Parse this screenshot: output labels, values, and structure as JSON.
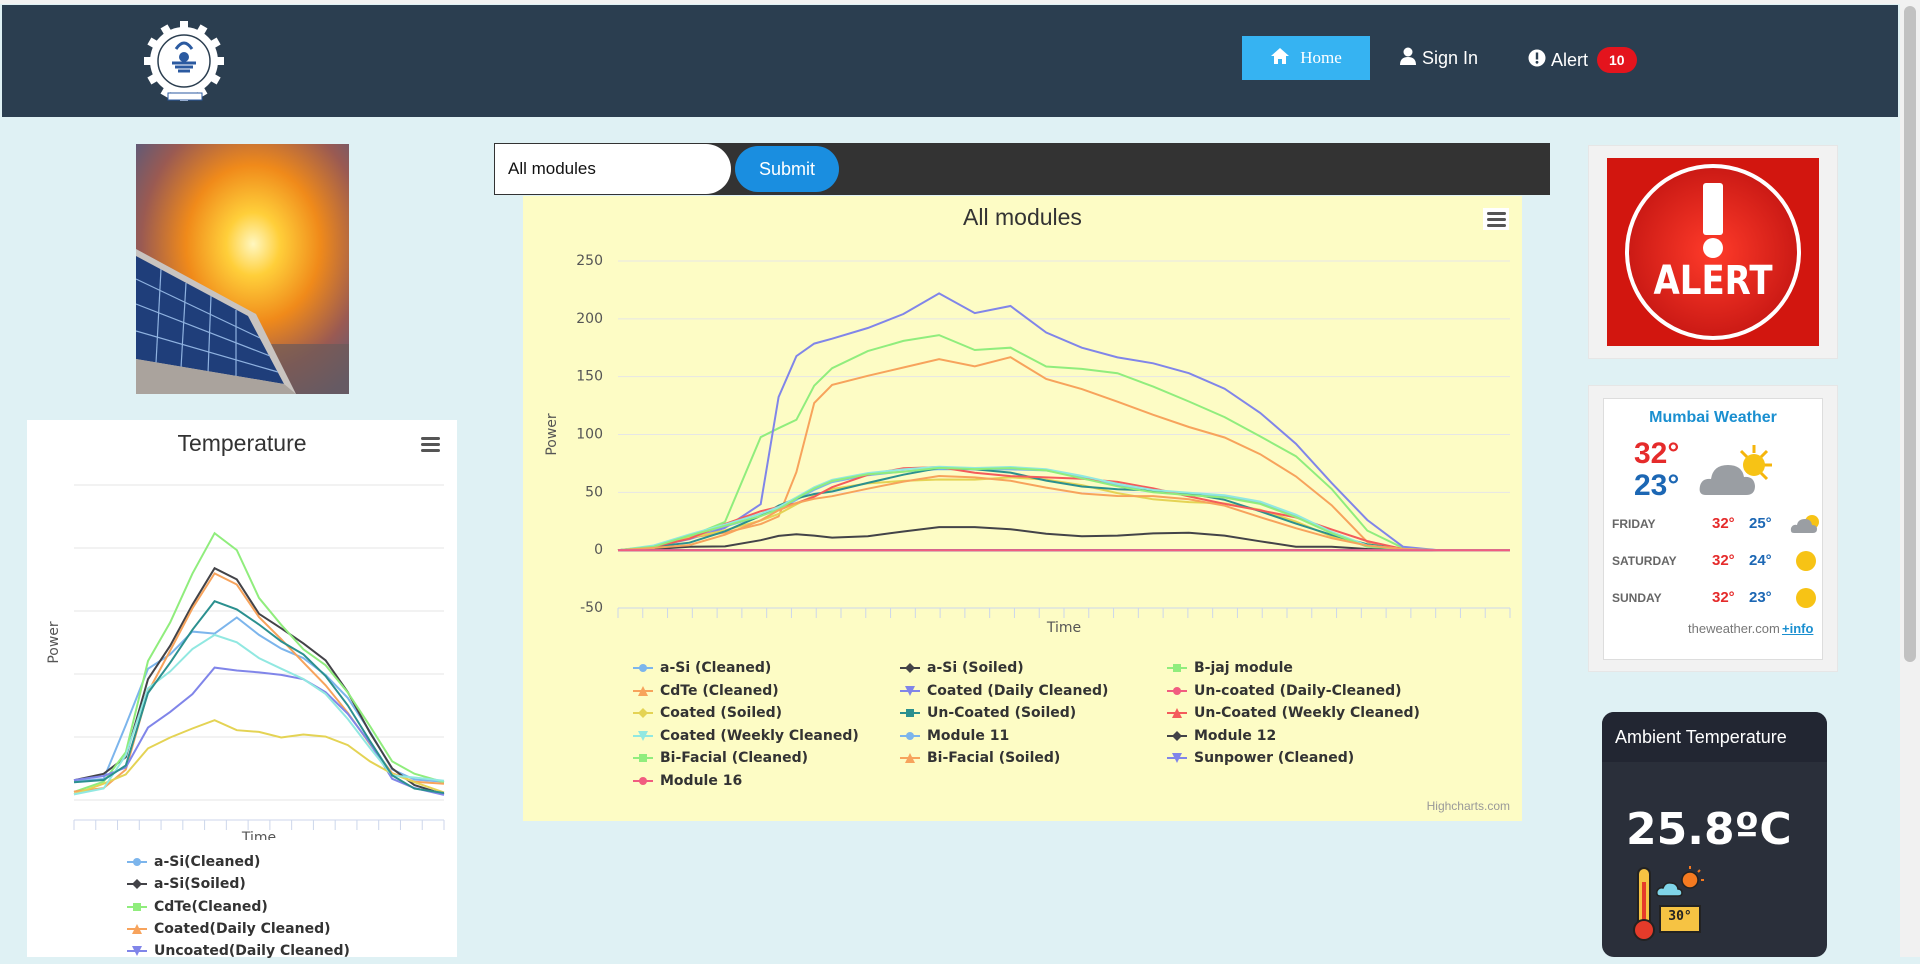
{
  "navbar": {
    "home_label": "Home",
    "signin_label": "Sign In",
    "alert_label": "Alert",
    "alert_count": "10"
  },
  "filter": {
    "selected_module": "All modules",
    "submit_label": "Submit"
  },
  "temperature_chart": {
    "title": "Temperature",
    "xlabel": "Time",
    "ylabel": "Power",
    "legend": [
      "a-Si(Cleaned)",
      "a-Si(Soiled)",
      "CdTe(Cleaned)",
      "Coated(Daily Cleaned)",
      "Uncoated(Daily Cleaned)"
    ]
  },
  "main_chart_labels": {
    "credits": "Highcharts.com"
  },
  "weather": {
    "title": "Mumbai Weather",
    "today_high": "32°",
    "today_low": "23°",
    "forecast": [
      {
        "day": "FRIDAY",
        "high": "32°",
        "low": "25°",
        "icon": "cloud-sun-icon"
      },
      {
        "day": "SATURDAY",
        "high": "32°",
        "low": "24°",
        "icon": "sun-icon"
      },
      {
        "day": "SUNDAY",
        "high": "32°",
        "low": "23°",
        "icon": "sun-icon"
      }
    ],
    "source": "theweather.com",
    "info_link": "+info"
  },
  "ambient": {
    "title": "Ambient Temperature",
    "value": "25.8ºC",
    "icon_text": "30°"
  },
  "alert_banner": {
    "text": "ALERT"
  },
  "colors": {
    "navbar": "#2b3e50",
    "home_active": "#36b3f2",
    "alert_badge": "#e4141d",
    "chart_bg": "#fdfcc5",
    "submit": "#1a8ee0"
  },
  "chart_data": [
    {
      "type": "line",
      "title": "All modules",
      "xlabel": "Time",
      "ylabel": "Power",
      "ylim": [
        -50,
        250
      ],
      "yticks": [
        -50,
        0,
        50,
        100,
        150,
        200,
        250
      ],
      "legend_position": "bottom",
      "grid": true,
      "x": [
        0,
        4,
        8,
        12,
        16,
        18,
        20,
        22,
        24,
        28,
        32,
        36,
        40,
        44,
        48,
        52,
        56,
        60,
        64,
        68,
        72,
        76,
        80,
        84,
        88,
        92,
        96,
        98,
        100
      ],
      "series": [
        {
          "name": "a-Si (Cleaned)",
          "color": "#7cb5ec",
          "marker": "circle",
          "values": [
            0,
            3,
            10,
            20,
            32,
            38,
            44,
            50,
            56,
            64,
            70,
            73,
            71,
            68,
            66,
            62,
            58,
            54,
            50,
            45,
            38,
            28,
            16,
            6,
            1,
            0,
            0,
            0,
            0
          ]
        },
        {
          "name": "a-Si (Soiled)",
          "color": "#434348",
          "marker": "diamond",
          "values": [
            0,
            1,
            3,
            6,
            9,
            10,
            11,
            12,
            13,
            15,
            17,
            18,
            17,
            17,
            16,
            15,
            14,
            13,
            12,
            11,
            9,
            6,
            3,
            1,
            0,
            0,
            0,
            0,
            0
          ]
        },
        {
          "name": "B-jaj module",
          "color": "#90ed7d",
          "marker": "square",
          "values": [
            0,
            3,
            12,
            22,
            95,
            105,
            115,
            145,
            158,
            170,
            178,
            185,
            175,
            178,
            160,
            155,
            150,
            140,
            130,
            118,
            100,
            80,
            50,
            15,
            2,
            0,
            0,
            0,
            0
          ]
        },
        {
          "name": "CdTe (Cleaned)",
          "color": "#f7a35c",
          "marker": "triangle",
          "values": [
            0,
            2,
            8,
            15,
            25,
            32,
            68,
            125,
            140,
            150,
            160,
            168,
            160,
            165,
            145,
            138,
            130,
            120,
            108,
            96,
            80,
            62,
            40,
            10,
            1,
            0,
            0,
            0,
            0
          ]
        },
        {
          "name": "Coated (Daily Cleaned)",
          "color": "#8085e9",
          "marker": "triangle-down",
          "values": [
            0,
            3,
            12,
            22,
            40,
            130,
            165,
            178,
            185,
            195,
            205,
            220,
            202,
            210,
            190,
            178,
            168,
            160,
            150,
            138,
            120,
            95,
            60,
            25,
            3,
            0,
            0,
            0,
            0
          ]
        },
        {
          "name": "Un-coated (Daily-Cleaned)",
          "color": "#f15c80",
          "marker": "circle",
          "values": [
            0,
            0,
            0,
            0,
            0,
            0,
            0,
            0,
            0,
            0,
            0,
            0,
            0,
            0,
            0,
            0,
            0,
            0,
            0,
            0,
            0,
            0,
            0,
            0,
            0,
            0,
            0,
            0,
            0
          ]
        },
        {
          "name": "Coated (Soiled)",
          "color": "#e4d354",
          "marker": "diamond",
          "values": [
            0,
            2,
            8,
            17,
            28,
            34,
            40,
            45,
            50,
            57,
            62,
            64,
            62,
            61,
            58,
            55,
            51,
            47,
            43,
            39,
            32,
            23,
            13,
            5,
            1,
            0,
            0,
            0,
            0
          ]
        },
        {
          "name": "Un-Coated (Soiled)",
          "color": "#2b908f",
          "marker": "square",
          "values": [
            0,
            3,
            9,
            19,
            30,
            36,
            42,
            48,
            53,
            61,
            66,
            69,
            67,
            66,
            62,
            58,
            54,
            50,
            46,
            42,
            35,
            26,
            15,
            5,
            1,
            0,
            0,
            0,
            0
          ]
        },
        {
          "name": "Un-Coated (Weekly Cleaned)",
          "color": "#f45b5b",
          "marker": "triangle",
          "values": [
            0,
            3,
            10,
            20,
            31,
            37,
            43,
            49,
            55,
            63,
            68,
            71,
            69,
            67,
            64,
            60,
            56,
            52,
            48,
            43,
            36,
            27,
            15,
            6,
            1,
            0,
            0,
            0,
            0
          ]
        },
        {
          "name": "Coated (Weekly Cleaned)",
          "color": "#91e8e1",
          "marker": "triangle-down",
          "values": [
            0,
            4,
            11,
            22,
            34,
            40,
            46,
            52,
            58,
            66,
            72,
            75,
            72,
            70,
            67,
            63,
            59,
            55,
            51,
            46,
            39,
            29,
            17,
            7,
            1,
            0,
            0,
            0,
            0
          ]
        },
        {
          "name": "Module 11",
          "color": "#7cb5ec",
          "marker": "circle",
          "values": [
            0,
            0,
            0,
            0,
            0,
            0,
            0,
            0,
            0,
            0,
            0,
            0,
            0,
            0,
            0,
            0,
            0,
            0,
            0,
            0,
            0,
            0,
            0,
            0,
            0,
            0,
            0,
            0,
            0
          ]
        },
        {
          "name": "Module 12",
          "color": "#434348",
          "marker": "diamond",
          "values": [
            0,
            0,
            0,
            0,
            0,
            0,
            0,
            0,
            0,
            0,
            0,
            0,
            0,
            0,
            0,
            0,
            0,
            0,
            0,
            0,
            0,
            0,
            0,
            0,
            0,
            0,
            0,
            0,
            0
          ]
        },
        {
          "name": "Bi-Facial (Cleaned)",
          "color": "#90ed7d",
          "marker": "square",
          "values": [
            0,
            3,
            10,
            21,
            32,
            38,
            45,
            51,
            57,
            65,
            70,
            74,
            71,
            69,
            66,
            61,
            57,
            53,
            49,
            44,
            37,
            27,
            16,
            6,
            1,
            0,
            0,
            0,
            0
          ]
        },
        {
          "name": "Bi-Facial (Soiled)",
          "color": "#f7a35c",
          "marker": "triangle",
          "values": [
            0,
            2,
            7,
            16,
            26,
            32,
            38,
            44,
            49,
            56,
            60,
            62,
            60,
            59,
            56,
            52,
            48,
            45,
            41,
            37,
            30,
            22,
            12,
            4,
            1,
            0,
            0,
            0,
            0
          ]
        },
        {
          "name": "Sunpower (Cleaned)",
          "color": "#8085e9",
          "marker": "triangle-down",
          "values": [
            0,
            0,
            0,
            0,
            0,
            0,
            0,
            0,
            0,
            0,
            0,
            0,
            0,
            0,
            0,
            0,
            0,
            0,
            0,
            0,
            0,
            0,
            0,
            0,
            0,
            0,
            0,
            0,
            0
          ]
        },
        {
          "name": "Module 16",
          "color": "#f15c80",
          "marker": "circle",
          "values": [
            0,
            0,
            0,
            0,
            0,
            0,
            0,
            0,
            0,
            0,
            0,
            0,
            0,
            0,
            0,
            0,
            0,
            0,
            0,
            0,
            0,
            0,
            0,
            0,
            0,
            0,
            0,
            0,
            0
          ]
        }
      ]
    },
    {
      "type": "line",
      "title": "Temperature",
      "xlabel": "Time",
      "ylabel": "Power",
      "ylim": [
        0,
        50
      ],
      "grid": true,
      "legend_position": "bottom",
      "x": [
        0,
        8,
        14,
        20,
        26,
        32,
        38,
        44,
        50,
        56,
        62,
        68,
        74,
        80,
        86,
        92,
        100
      ],
      "series": [
        {
          "name": "a-Si(Cleaned)",
          "color": "#7cb5ec",
          "values": [
            3,
            4,
            13,
            22,
            24,
            27,
            26,
            28,
            25,
            23,
            22,
            20,
            17,
            12,
            6,
            4,
            3
          ]
        },
        {
          "name": "a-Si(Soiled)",
          "color": "#434348",
          "values": [
            2,
            3,
            6,
            19,
            25,
            32,
            38,
            36,
            30,
            27,
            24,
            21,
            16,
            10,
            5,
            3,
            2
          ]
        },
        {
          "name": "CdTe(Cleaned)",
          "color": "#90ed7d",
          "values": [
            2,
            3,
            7,
            21,
            27,
            35,
            42,
            40,
            33,
            29,
            25,
            22,
            17,
            11,
            5,
            3,
            2
          ]
        },
        {
          "name": "Coated(Daily Cleaned)",
          "color": "#f7a35c",
          "values": [
            2,
            3,
            6,
            18,
            24,
            30,
            35,
            33,
            28,
            25,
            22,
            19,
            15,
            10,
            5,
            3,
            2
          ]
        },
        {
          "name": "Uncoated(Daily Cleaned)",
          "color": "#8085e9",
          "values": [
            2,
            3,
            5,
            12,
            15,
            18,
            22,
            21,
            20,
            19,
            18,
            16,
            13,
            9,
            4,
            3,
            2
          ]
        },
        {
          "name": "",
          "color": "#e4d354",
          "values": [
            1,
            2,
            3,
            7,
            9,
            11,
            13,
            12,
            12,
            11,
            11,
            10,
            8,
            5,
            3,
            2,
            1
          ]
        },
        {
          "name": "",
          "color": "#91e8e1",
          "values": [
            2,
            3,
            8,
            18,
            20,
            23,
            25,
            24,
            22,
            21,
            20,
            18,
            14,
            9,
            4,
            3,
            2
          ]
        },
        {
          "name": "",
          "color": "#2b908f",
          "values": [
            2,
            3,
            6,
            18,
            23,
            28,
            32,
            30,
            27,
            24,
            22,
            19,
            15,
            10,
            5,
            3,
            2
          ]
        }
      ]
    }
  ]
}
